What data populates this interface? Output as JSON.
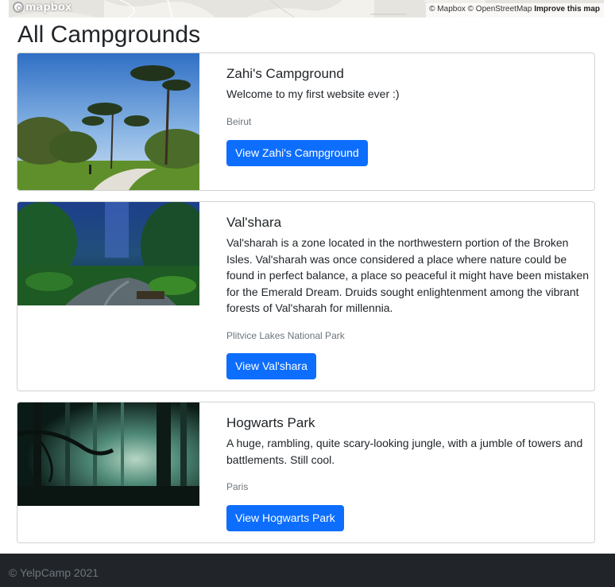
{
  "map": {
    "logo_text": "mapbox",
    "attribution": "© Mapbox © OpenStreetMap",
    "improve_link": "Improve this map"
  },
  "page": {
    "title": "All Campgrounds"
  },
  "campgrounds": [
    {
      "title": "Zahi's Campground",
      "description": "Welcome to my first website ever :)",
      "location": "Beirut",
      "button": "View Zahi's Campground",
      "image_icon": "park-trees-photo"
    },
    {
      "title": "Val'shara",
      "description": "Val'sharah is a zone located in the northwestern portion of the Broken Isles. Val'sharah was once considered a place where nature could be found in perfect balance, a place so peaceful it might have been mistaken for the Emerald Dream. Druids sought enlightenment among the vibrant forests of Val'sharah for millennia.",
      "location": "Plitvice Lakes National Park",
      "button": "View Val'shara",
      "image_icon": "fantasy-forest-photo"
    },
    {
      "title": "Hogwarts Park",
      "description": "A huge, rambling, quite scary-looking jungle, with a jumble of towers and battlements. Still cool.",
      "location": "Paris",
      "button": "View Hogwarts Park",
      "image_icon": "dark-forest-photo"
    }
  ],
  "footer": {
    "text": "© YelpCamp 2021"
  },
  "colors": {
    "primary": "#0d6efd",
    "footer_bg": "#212529",
    "muted": "#6c757d"
  }
}
